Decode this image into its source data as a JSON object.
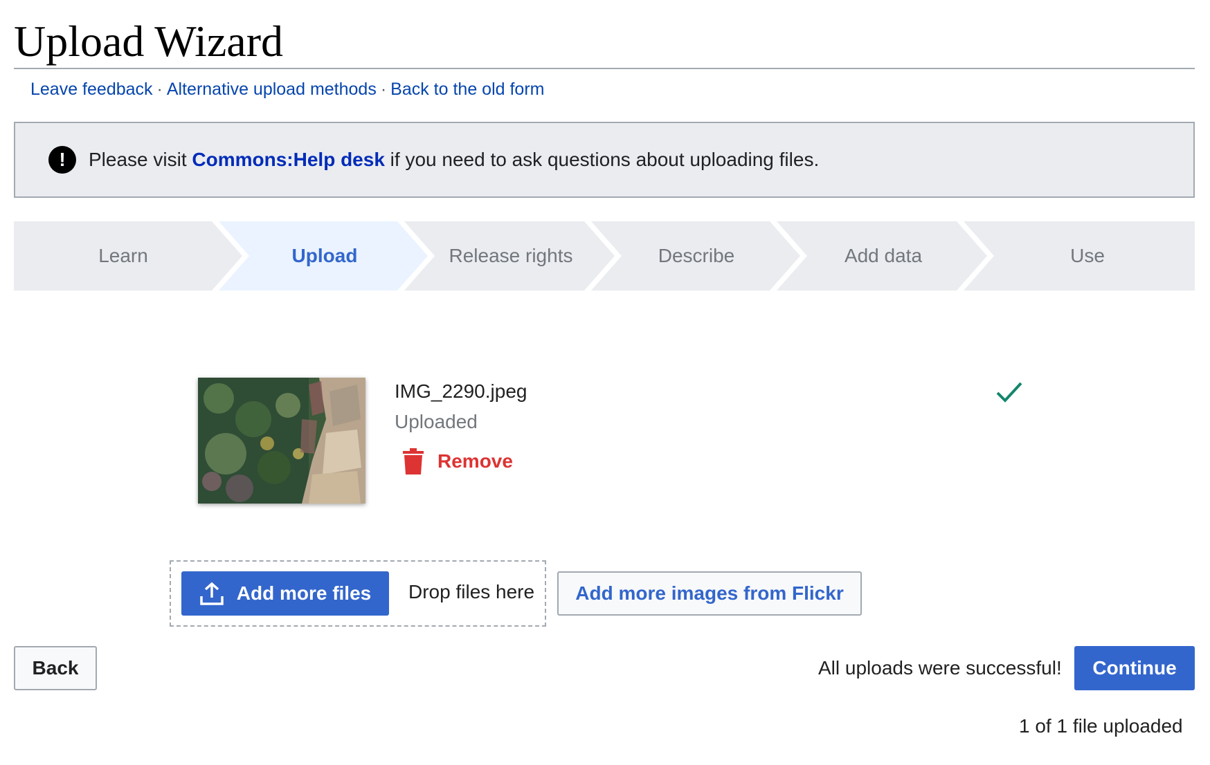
{
  "header": {
    "title": "Upload Wizard",
    "links": [
      {
        "label": "Leave feedback"
      },
      {
        "label": "Alternative upload methods"
      },
      {
        "label": "Back to the old form"
      }
    ],
    "separator": "·"
  },
  "notice": {
    "icon": "exclamation-icon",
    "prefix": "Please visit ",
    "link_label": "Commons:Help desk",
    "suffix": " if you need to ask questions about uploading files."
  },
  "steps": [
    {
      "label": "Learn",
      "active": false
    },
    {
      "label": "Upload",
      "active": true
    },
    {
      "label": "Release rights",
      "active": false
    },
    {
      "label": "Describe",
      "active": false
    },
    {
      "label": "Add data",
      "active": false
    },
    {
      "label": "Use",
      "active": false
    }
  ],
  "file": {
    "name": "IMG_2290.jpeg",
    "status": "Uploaded",
    "remove_label": "Remove",
    "status_icon": "checkmark-icon"
  },
  "upload_controls": {
    "add_files_label": "Add more files",
    "drop_text": "Drop files here",
    "flickr_label": "Add more images from Flickr"
  },
  "footer": {
    "back_label": "Back",
    "success_message": "All uploads were successful!",
    "continue_label": "Continue",
    "count_message": "1 of 1 file uploaded"
  },
  "colors": {
    "accent": "#3366cc",
    "link": "#0645ad",
    "destructive": "#dd3333",
    "success": "#14866d",
    "step_bg": "#eaecf0",
    "step_active_bg": "#eaf3ff"
  }
}
